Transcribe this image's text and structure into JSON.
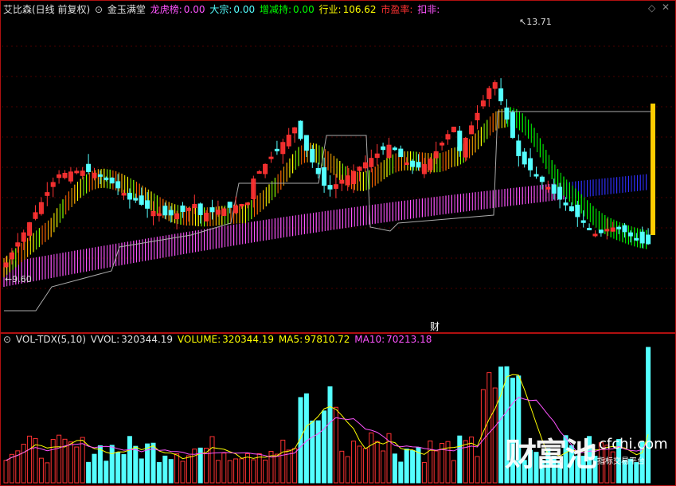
{
  "header": {
    "stock": "艾比森(日线 前复权)",
    "indicator": "金玉满堂",
    "longhu_label": "龙虎榜:",
    "longhu_value": "0.00",
    "dazong_label": "大宗:",
    "dazong_value": "0.00",
    "zengjian_label": "增减持:",
    "zengjian_value": "0.00",
    "hangye_label": "行业:",
    "hangye_value": "106.62",
    "pe_label": "市盈率:",
    "koufei_label": "扣非:"
  },
  "price_annotations": {
    "high": "13.71",
    "low": "9.60"
  },
  "finance_marker": "财",
  "volume_header": {
    "name": "VOL-TDX(5,10)",
    "vvol_label": "VVOL:",
    "vvol_value": "320344.19",
    "volume_label": "VOLUME:",
    "volume_value": "320344.19",
    "ma5_label": "MA5:",
    "ma5_value": "97810.72",
    "ma10_label": "MA10:",
    "ma10_value": "70213.18"
  },
  "watermark": {
    "brand": "财富池",
    "site": "cfchi.com",
    "tagline": "指标交易平台"
  },
  "icons": {
    "window_restore": "diamond-icon",
    "window_close": "close-icon",
    "volume_menu": "circle-down-icon"
  },
  "colors": {
    "up": "#ff3232",
    "down": "#54ffff",
    "ma5": "#ffff00",
    "ma10": "#ff54ff",
    "band_mid": "#00ff00",
    "band_long": "#ff54ff",
    "band_blue": "#3030ff",
    "bar_yellow": "#ffcc00"
  },
  "chart_data": {
    "type": "candlestick",
    "price_range": [
      8.8,
      14.0
    ],
    "high_label": 13.71,
    "low_label": 9.6
  }
}
